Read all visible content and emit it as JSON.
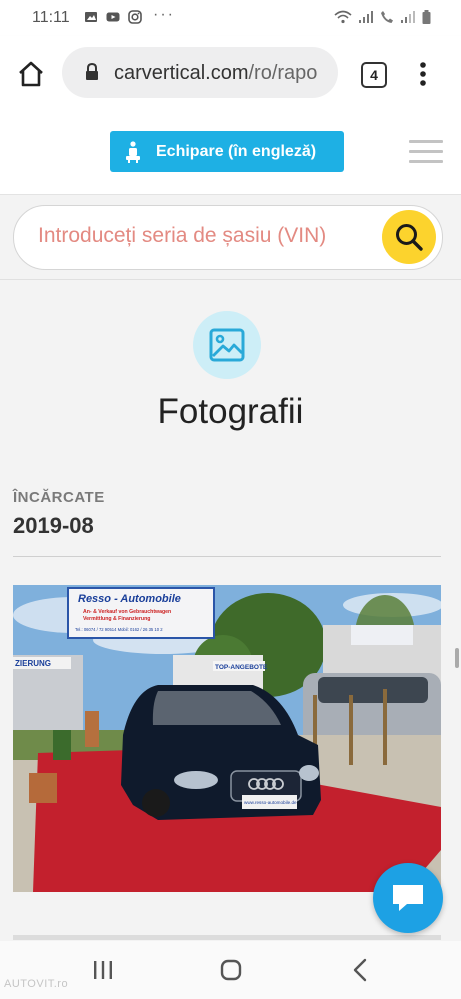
{
  "status_bar": {
    "time": "11:11",
    "more": "···"
  },
  "browser": {
    "url_host": "carvertical.com",
    "url_path": "/ro/rapo",
    "tab_count": "4"
  },
  "header": {
    "equipment_button": "Echipare (în engleză)"
  },
  "search": {
    "placeholder": "Introduceți seria de șasiu (VIN)"
  },
  "photos_section": {
    "title": "Fotografii",
    "uploaded_label": "ÎNCĂRCATE",
    "uploaded_date": "2019-08",
    "photo": {
      "dealer_sign": "Resso - Automobile",
      "sign_line1": "An- & Verkauf von Gebrauchtwagen",
      "sign_line2": "Vermittlung & Finanzierung",
      "sign_line3": "Tel.: 06074 / 72 90514  Mobil: 0162 / 26 35 10 2",
      "left_banner": "ZIERUNG",
      "top_banner": "TOP-ANGEBOTE",
      "plate_text": "www.resso-automobile.de"
    }
  },
  "watermark": "AUTOVIT.ro",
  "colors": {
    "accent_blue": "#1eb0e4",
    "search_yellow": "#fcd32d",
    "placeholder_red": "#e38a82",
    "chat_blue": "#1da1e4"
  }
}
